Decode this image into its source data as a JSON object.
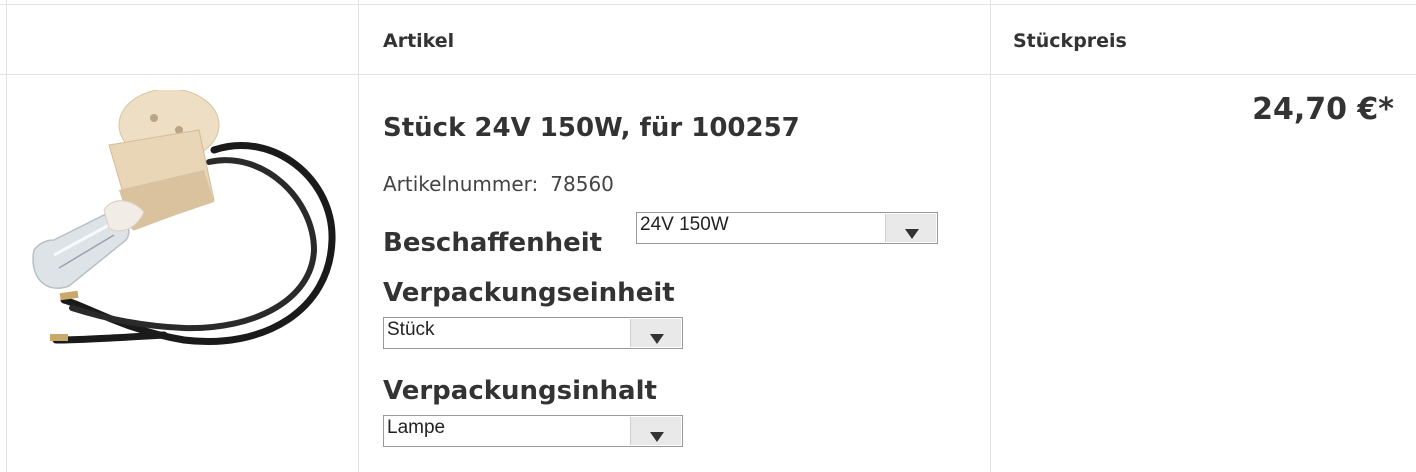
{
  "table": {
    "header": {
      "article": "Artikel",
      "unit_price": "Stückpreis"
    }
  },
  "product": {
    "image_icon": "lamp-with-socket-product-photo",
    "name": "Stück 24V 150W, für 100257",
    "article_number_label": "Artikelnummer:",
    "article_number": "78560",
    "price": "24,70 €*"
  },
  "options": {
    "beschaffenheit": {
      "label": "Beschaffenheit",
      "selected": "24V 150W"
    },
    "verpackungseinheit": {
      "label": "Verpackungseinheit",
      "selected": "Stück"
    },
    "verpackungsinhalt": {
      "label": "Verpackungsinhalt",
      "selected": "Lampe"
    }
  }
}
